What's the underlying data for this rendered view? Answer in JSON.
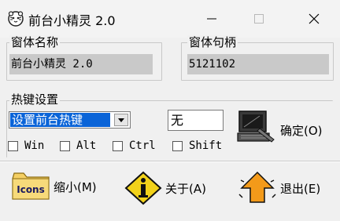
{
  "window": {
    "title": "前台小精灵 2.0",
    "app_icon": "tiger-face-icon",
    "controls": [
      "minimize-icon",
      "maximize-icon",
      "close-icon"
    ]
  },
  "window_name": {
    "label": "窗体名称",
    "value": "前台小精灵 2.0"
  },
  "window_handle": {
    "label": "窗体句柄",
    "value": "5121102"
  },
  "hotkey": {
    "label": "热键设置",
    "selected_option": "设置前台热键",
    "key_value": "无",
    "modifiers": [
      {
        "label": "Win",
        "checked": false
      },
      {
        "label": "Alt",
        "checked": false
      },
      {
        "label": "Ctrl",
        "checked": false
      },
      {
        "label": "Shift",
        "checked": false
      }
    ],
    "confirm_label": "确定(O)",
    "confirm_icon": "computer-with-pen-icon"
  },
  "actions": {
    "minimize_label": "缩小(M)",
    "minimize_icon_text": "Icons",
    "about_label": "关于(A)",
    "exit_label": "退出(E)"
  },
  "colors": {
    "selection": "#0a64d8",
    "field_bg": "#c9c9c9",
    "info_yellow": "#f2d21a",
    "exit_orange": "#f39a1a"
  }
}
